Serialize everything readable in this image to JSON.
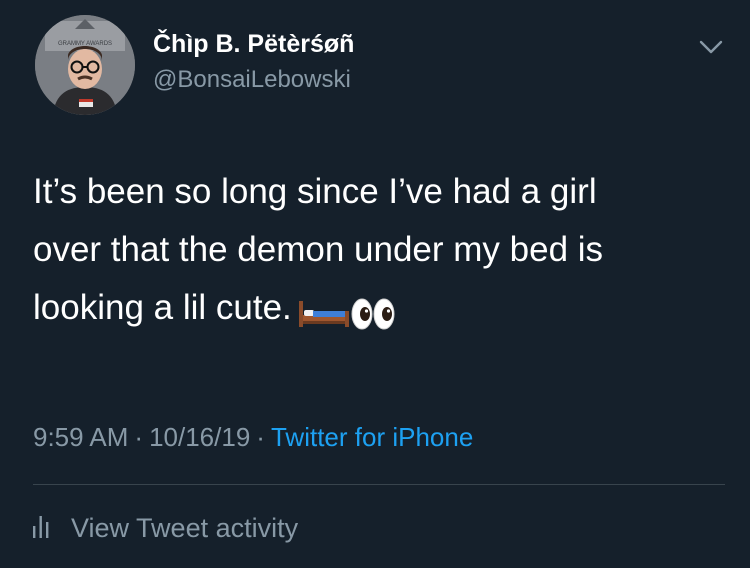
{
  "tweet": {
    "author": {
      "display_name": "Čhìp B. Pëtèrśøñ",
      "handle": "@BonsaiLebowski",
      "avatar_icon": "user-avatar",
      "avatar_badge_text": "GRAMMY AWARDS"
    },
    "menu_icon": "chevron-down-icon",
    "text_lines": [
      "It’s been so long since I’ve had a girl",
      "over that the demon under my bed is",
      "looking a lil cute."
    ],
    "emojis": [
      "bed-emoji",
      "eyes-emoji"
    ],
    "time": "9:59 AM",
    "date": "10/16/19",
    "separator": "·",
    "source": "Twitter for iPhone",
    "activity": {
      "icon": "bar-chart-icon",
      "label": "View Tweet activity"
    }
  },
  "colors": {
    "background": "#15202b",
    "primary_text": "#ffffff",
    "secondary_text": "#8899a6",
    "link": "#1da1f2",
    "divider": "#38444d"
  }
}
